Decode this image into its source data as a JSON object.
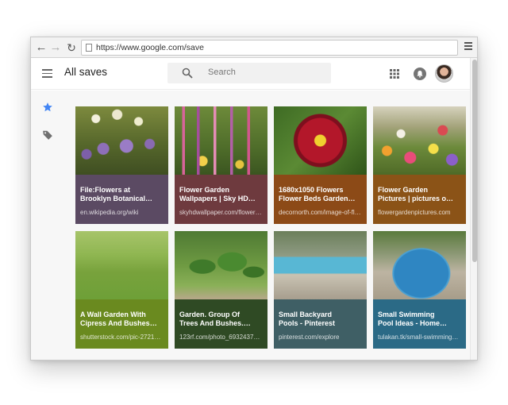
{
  "browser": {
    "url": "https://www.google.com/save"
  },
  "header": {
    "title": "All saves",
    "search_placeholder": "Search"
  },
  "colors": {
    "accent_star": "#4285f4"
  },
  "cards": [
    {
      "title_line1": "File:Flowers at",
      "title_line2": "Brooklyn Botanical…",
      "source": "en.wikipedia.org/wiki",
      "color": "#5b4a63"
    },
    {
      "title_line1": "Flower Garden",
      "title_line2": "Wallpapers | Sky HD…",
      "source": "skyhdwallpaper.com/flower…",
      "color": "#6e3a3e"
    },
    {
      "title_line1": "1680x1050 Flowers",
      "title_line2": "Flower Beds Garden…",
      "source": "decornorth.com/image-of-fl…",
      "color": "#8c4a17"
    },
    {
      "title_line1": "Flower Garden",
      "title_line2": "Pictures | pictures o…",
      "source": "flowergardenpictures.com",
      "color": "#8b5317"
    },
    {
      "title_line1": "A Wall Garden With",
      "title_line2": "Cipress And Bushes…",
      "source": "shutterstock.com/pic-2721…",
      "color": "#6a8a1f"
    },
    {
      "title_line1": "Garden. Group Of",
      "title_line2": "Trees And Bushes.…",
      "source": "123rf.com/photo_6932437…",
      "color": "#2f4a24"
    },
    {
      "title_line1": "Small Backyard",
      "title_line2": "Pools - Pinterest",
      "source": "pinterest.com/explore",
      "color": "#3f5f65"
    },
    {
      "title_line1": "Small Swimming",
      "title_line2": "Pool Ideas - Home…",
      "source": "tulakan.tk/small-swimming…",
      "color": "#2b6a86"
    }
  ]
}
